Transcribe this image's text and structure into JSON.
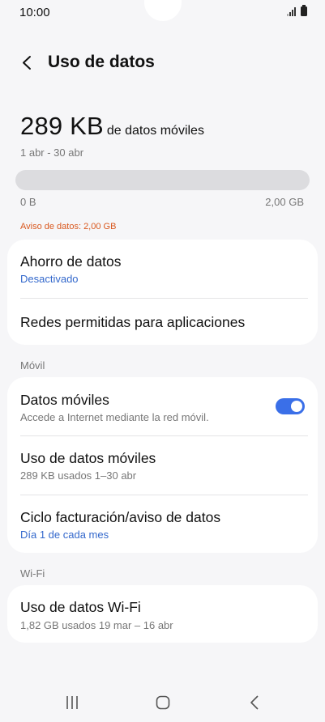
{
  "status_bar": {
    "time": "10:00"
  },
  "header": {
    "title": "Uso de datos"
  },
  "usage": {
    "amount": "289 KB",
    "suffix": "de datos móviles",
    "period": "1 abr - 30 abr",
    "bar_min": "0 B",
    "bar_max": "2,00 GB",
    "fill_fraction": 0.0001,
    "warning": "Aviso de datos: 2,00 GB"
  },
  "card1": {
    "saver_title": "Ahorro de datos",
    "saver_status": "Desactivado",
    "allowed_networks": "Redes permitidas para aplicaciones"
  },
  "mobile_section": {
    "label": "Móvil",
    "mobile_data_title": "Datos móviles",
    "mobile_data_sub": "Accede a Internet mediante la red móvil.",
    "mobile_data_enabled": true,
    "mobile_usage_title": "Uso de datos móviles",
    "mobile_usage_sub": "289 KB usados 1–30 abr",
    "billing_title": "Ciclo facturación/aviso de datos",
    "billing_sub": "Día 1 de cada mes"
  },
  "wifi_section": {
    "label": "Wi-Fi",
    "wifi_usage_title": "Uso de datos Wi-Fi",
    "wifi_usage_sub": "1,82 GB usados 19 mar – 16 abr"
  },
  "colors": {
    "accent": "#3a6fe8",
    "warning": "#d9581e",
    "link": "#3368cc"
  }
}
